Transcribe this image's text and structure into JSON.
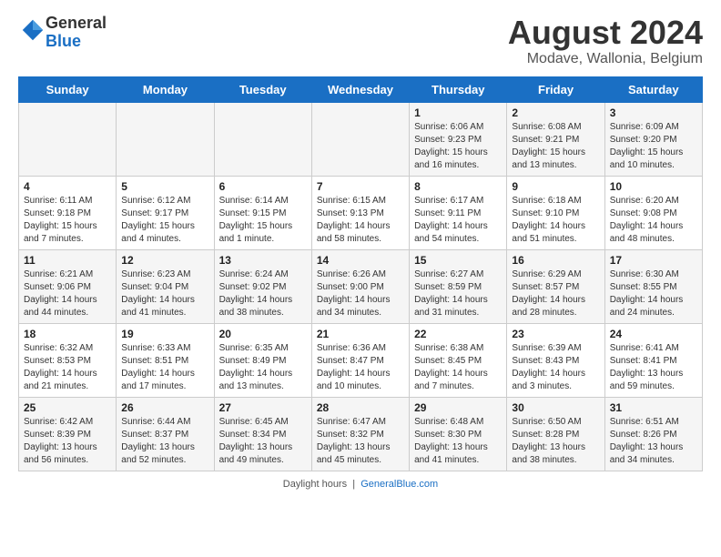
{
  "header": {
    "logo_text_general": "General",
    "logo_text_blue": "Blue",
    "main_title": "August 2024",
    "subtitle": "Modave, Wallonia, Belgium"
  },
  "days_of_week": [
    "Sunday",
    "Monday",
    "Tuesday",
    "Wednesday",
    "Thursday",
    "Friday",
    "Saturday"
  ],
  "weeks": [
    [
      {
        "day": "",
        "info": ""
      },
      {
        "day": "",
        "info": ""
      },
      {
        "day": "",
        "info": ""
      },
      {
        "day": "",
        "info": ""
      },
      {
        "day": "1",
        "info": "Sunrise: 6:06 AM\nSunset: 9:23 PM\nDaylight: 15 hours and 16 minutes."
      },
      {
        "day": "2",
        "info": "Sunrise: 6:08 AM\nSunset: 9:21 PM\nDaylight: 15 hours and 13 minutes."
      },
      {
        "day": "3",
        "info": "Sunrise: 6:09 AM\nSunset: 9:20 PM\nDaylight: 15 hours and 10 minutes."
      }
    ],
    [
      {
        "day": "4",
        "info": "Sunrise: 6:11 AM\nSunset: 9:18 PM\nDaylight: 15 hours and 7 minutes."
      },
      {
        "day": "5",
        "info": "Sunrise: 6:12 AM\nSunset: 9:17 PM\nDaylight: 15 hours and 4 minutes."
      },
      {
        "day": "6",
        "info": "Sunrise: 6:14 AM\nSunset: 9:15 PM\nDaylight: 15 hours and 1 minute."
      },
      {
        "day": "7",
        "info": "Sunrise: 6:15 AM\nSunset: 9:13 PM\nDaylight: 14 hours and 58 minutes."
      },
      {
        "day": "8",
        "info": "Sunrise: 6:17 AM\nSunset: 9:11 PM\nDaylight: 14 hours and 54 minutes."
      },
      {
        "day": "9",
        "info": "Sunrise: 6:18 AM\nSunset: 9:10 PM\nDaylight: 14 hours and 51 minutes."
      },
      {
        "day": "10",
        "info": "Sunrise: 6:20 AM\nSunset: 9:08 PM\nDaylight: 14 hours and 48 minutes."
      }
    ],
    [
      {
        "day": "11",
        "info": "Sunrise: 6:21 AM\nSunset: 9:06 PM\nDaylight: 14 hours and 44 minutes."
      },
      {
        "day": "12",
        "info": "Sunrise: 6:23 AM\nSunset: 9:04 PM\nDaylight: 14 hours and 41 minutes."
      },
      {
        "day": "13",
        "info": "Sunrise: 6:24 AM\nSunset: 9:02 PM\nDaylight: 14 hours and 38 minutes."
      },
      {
        "day": "14",
        "info": "Sunrise: 6:26 AM\nSunset: 9:00 PM\nDaylight: 14 hours and 34 minutes."
      },
      {
        "day": "15",
        "info": "Sunrise: 6:27 AM\nSunset: 8:59 PM\nDaylight: 14 hours and 31 minutes."
      },
      {
        "day": "16",
        "info": "Sunrise: 6:29 AM\nSunset: 8:57 PM\nDaylight: 14 hours and 28 minutes."
      },
      {
        "day": "17",
        "info": "Sunrise: 6:30 AM\nSunset: 8:55 PM\nDaylight: 14 hours and 24 minutes."
      }
    ],
    [
      {
        "day": "18",
        "info": "Sunrise: 6:32 AM\nSunset: 8:53 PM\nDaylight: 14 hours and 21 minutes."
      },
      {
        "day": "19",
        "info": "Sunrise: 6:33 AM\nSunset: 8:51 PM\nDaylight: 14 hours and 17 minutes."
      },
      {
        "day": "20",
        "info": "Sunrise: 6:35 AM\nSunset: 8:49 PM\nDaylight: 14 hours and 13 minutes."
      },
      {
        "day": "21",
        "info": "Sunrise: 6:36 AM\nSunset: 8:47 PM\nDaylight: 14 hours and 10 minutes."
      },
      {
        "day": "22",
        "info": "Sunrise: 6:38 AM\nSunset: 8:45 PM\nDaylight: 14 hours and 7 minutes."
      },
      {
        "day": "23",
        "info": "Sunrise: 6:39 AM\nSunset: 8:43 PM\nDaylight: 14 hours and 3 minutes."
      },
      {
        "day": "24",
        "info": "Sunrise: 6:41 AM\nSunset: 8:41 PM\nDaylight: 13 hours and 59 minutes."
      }
    ],
    [
      {
        "day": "25",
        "info": "Sunrise: 6:42 AM\nSunset: 8:39 PM\nDaylight: 13 hours and 56 minutes."
      },
      {
        "day": "26",
        "info": "Sunrise: 6:44 AM\nSunset: 8:37 PM\nDaylight: 13 hours and 52 minutes."
      },
      {
        "day": "27",
        "info": "Sunrise: 6:45 AM\nSunset: 8:34 PM\nDaylight: 13 hours and 49 minutes."
      },
      {
        "day": "28",
        "info": "Sunrise: 6:47 AM\nSunset: 8:32 PM\nDaylight: 13 hours and 45 minutes."
      },
      {
        "day": "29",
        "info": "Sunrise: 6:48 AM\nSunset: 8:30 PM\nDaylight: 13 hours and 41 minutes."
      },
      {
        "day": "30",
        "info": "Sunrise: 6:50 AM\nSunset: 8:28 PM\nDaylight: 13 hours and 38 minutes."
      },
      {
        "day": "31",
        "info": "Sunrise: 6:51 AM\nSunset: 8:26 PM\nDaylight: 13 hours and 34 minutes."
      }
    ]
  ],
  "footer": {
    "daylight_hours": "Daylight hours",
    "site": "GeneralBlue.com"
  }
}
